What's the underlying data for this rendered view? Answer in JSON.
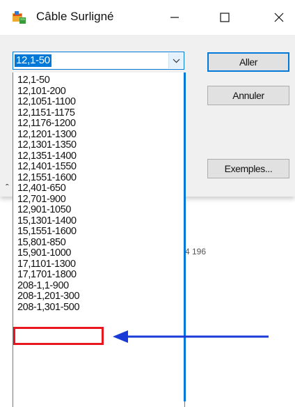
{
  "window": {
    "title": "Câble Surligné",
    "app_icon": "windows-forms-app-icon",
    "controls": [
      "minimize-icon",
      "maximize-icon",
      "close-icon"
    ]
  },
  "combo": {
    "selected": "12,1-50",
    "arrow_icon": "chevron-down-icon"
  },
  "dropdown": {
    "items": [
      "12,1-50",
      "12,101-200",
      "12,1051-1100",
      "12,1151-1175",
      "12,1176-1200",
      "12,1201-1300",
      "12,1301-1350",
      "12,1351-1400",
      "12,1401-1550",
      "12,1551-1600",
      "12,401-650",
      "12,701-900",
      "12,901-1050",
      "15,1301-1400",
      "15,1551-1600",
      "15,801-850",
      "15,901-1000",
      "17,1101-1300",
      "17,1701-1800",
      "208-1,1-900",
      "208-1,201-300",
      "208-1,301-500"
    ]
  },
  "buttons": {
    "aller": "Aller",
    "annuler": "Annuler",
    "exemples": "Exemples..."
  },
  "background": {
    "partial_text": "4 196"
  },
  "annotation": {
    "highlighted_item": "17,1101-1300",
    "box_color": "#e8161e",
    "arrow_color": "#1a3ad8"
  },
  "colors": {
    "accent": "#0078d7"
  }
}
